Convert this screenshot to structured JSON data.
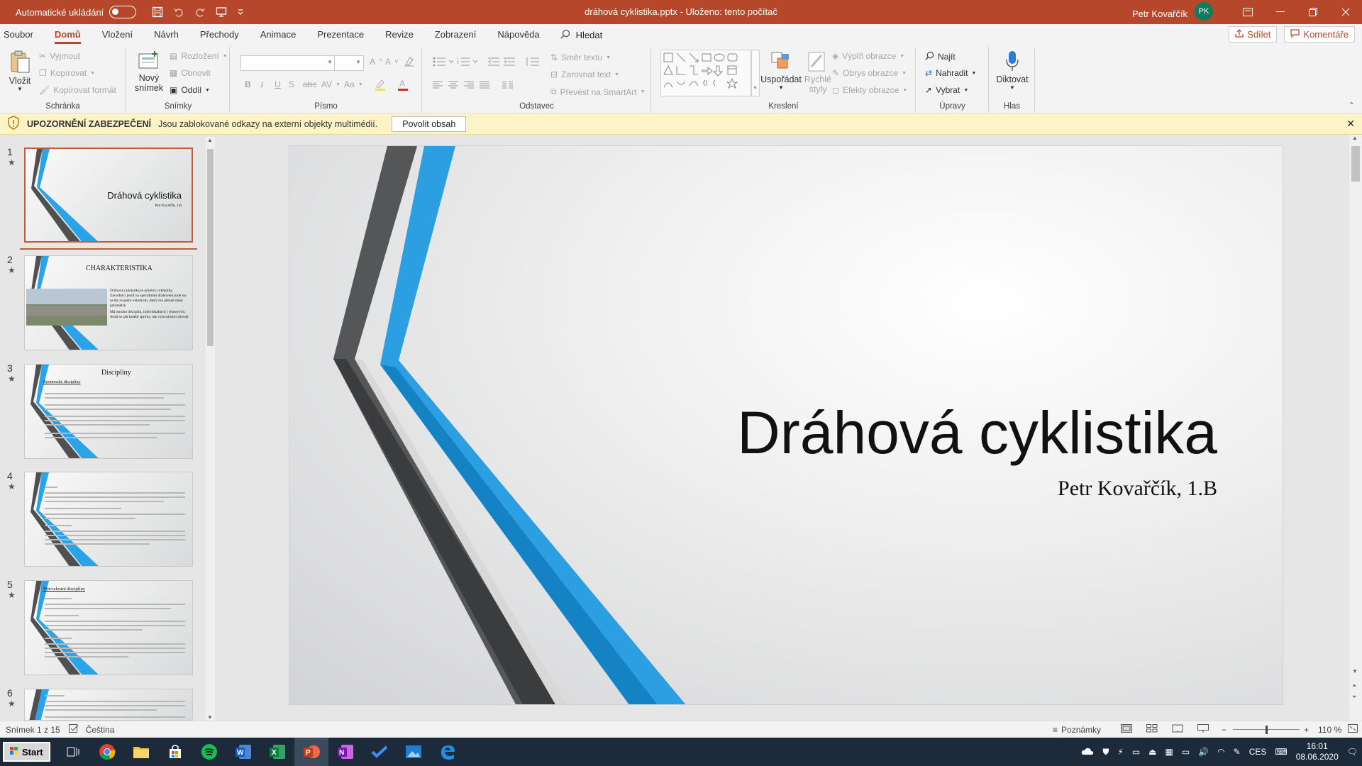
{
  "titlebar": {
    "autosave_label": "Automatické ukládání",
    "doc_title": "dráhová cyklistika.pptx  -  Uloženo: tento počítač",
    "user_name": "Petr Kovařčík",
    "user_initials": "PK"
  },
  "tabs": [
    "Soubor",
    "Domů",
    "Vložení",
    "Návrh",
    "Přechody",
    "Animace",
    "Prezentace",
    "Revize",
    "Zobrazení",
    "Nápověda"
  ],
  "active_tab": "Domů",
  "search_label": "Hledat",
  "share_label": "Sdílet",
  "comments_label": "Komentáře",
  "ribbon": {
    "clipboard": {
      "paste": "Vložit",
      "cut": "Vyjmout",
      "copy": "Kopírovat",
      "format_painter": "Kopírovat formát",
      "label": "Schránka"
    },
    "slides": {
      "new_slide_1": "Nový",
      "new_slide_2": "snímek",
      "layout": "Rozložení",
      "reset": "Obnovit",
      "section": "Oddíl",
      "label": "Snímky"
    },
    "font": {
      "bold": "B",
      "italic": "I",
      "underline": "U",
      "strike": "S",
      "spacing": "AV",
      "case": "Aa",
      "label": "Písmo"
    },
    "paragraph": {
      "direction": "Směr textu",
      "align": "Zarovnat text",
      "smartart": "Převést na SmartArt",
      "label": "Odstavec"
    },
    "drawing": {
      "arrange": "Uspořádat",
      "quick_styles_1": "Rychlé",
      "quick_styles_2": "styly",
      "fill": "Výplň obrazce",
      "outline": "Obrys obrazce",
      "effects": "Efekty obrazce",
      "label": "Kreslení"
    },
    "editing": {
      "find": "Najít",
      "replace": "Nahradit",
      "select": "Vybrat",
      "label": "Úpravy"
    },
    "voice": {
      "dictate": "Diktovat",
      "label": "Hlas"
    }
  },
  "security": {
    "title": "UPOZORNĚNÍ ZABEZPEČENÍ",
    "message": "Jsou zablokované odkazy na externí objekty multimédií.",
    "button": "Povolit obsah"
  },
  "thumbnails": [
    {
      "num": "1",
      "title": "Dráhová cyklistika",
      "sub": "Petr Kovařčík, 1.B"
    },
    {
      "num": "2",
      "title": "CHARAKTERISTIKA",
      "bullet1": "Dráhová cyklistika je odvětví cyklistiky. Závodníci jezdí na speciálním dráhovém kole na ovále zvaném velodrom, který má přesně dané parametry.",
      "bullet2": "Má mnoho disciplín, individuálních i týmových. Jezdí se jak krátké sprinty, tak vytrvalostní závody"
    },
    {
      "num": "3",
      "title": "Disciplíny",
      "sub": "Sprinterské disciplíny"
    },
    {
      "num": "4"
    },
    {
      "num": "5",
      "sub": "Vytrvalostní disciplíny"
    },
    {
      "num": "6"
    }
  ],
  "slide": {
    "title": "Dráhová cyklistika",
    "subtitle": "Petr Kovařčík, 1.B"
  },
  "statusbar": {
    "slide_count": "Snímek 1 z 15",
    "language": "Čeština",
    "notes": "Poznámky",
    "zoom": "110 %"
  },
  "taskbar": {
    "start": "Start",
    "lang": "CES",
    "time": "16:01",
    "date": "08.06.2020"
  },
  "colors": {
    "accent": "#b7472a",
    "slide_blue": "#2a8fd0",
    "slide_dark": "#3a3a3a"
  }
}
